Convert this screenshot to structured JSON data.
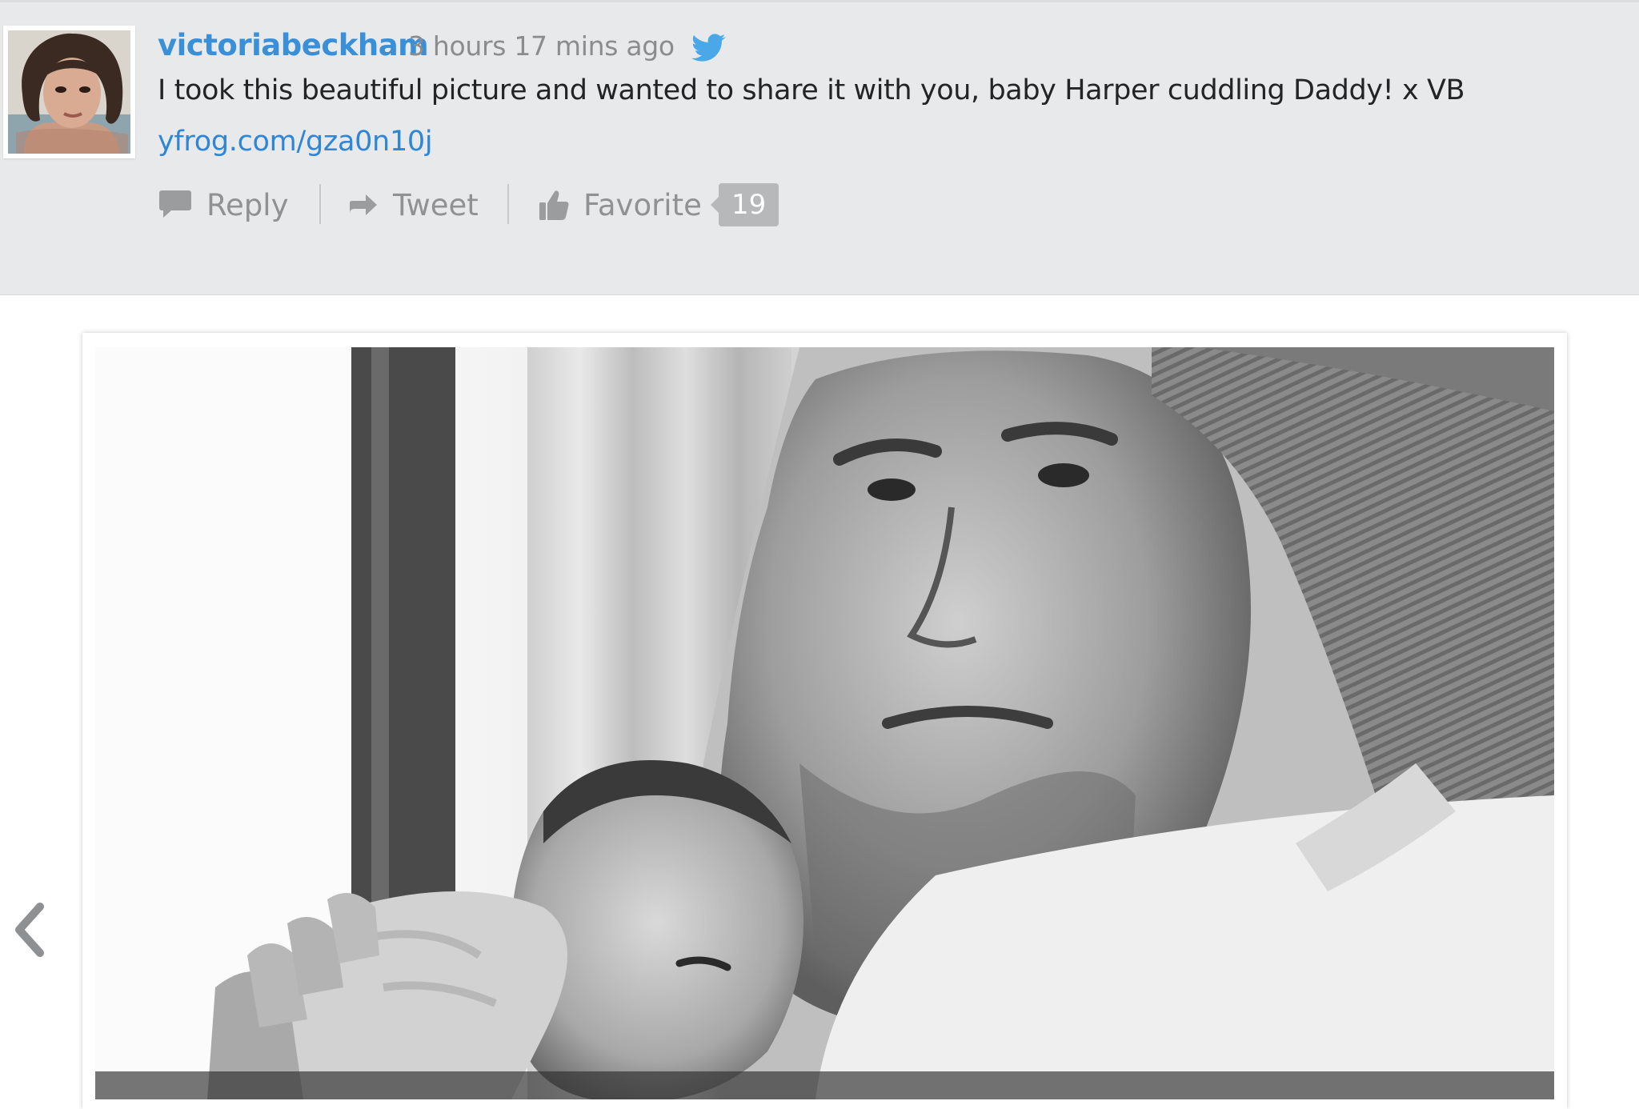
{
  "tweet": {
    "username": "victoriabeckham",
    "time_ago": "3 hours 17 mins ago",
    "source_icon": "twitter-bird-icon",
    "text": "I took this beautiful picture and wanted to share it with you, baby Harper cuddling Daddy! x VB",
    "link": "yfrog.com/gza0n10j",
    "actions": {
      "reply_label": "Reply",
      "retweet_label": "Tweet",
      "favorite_label": "Favorite",
      "favorite_count": "19"
    }
  },
  "colors": {
    "username": "#3a8fd9",
    "link": "#2e86d6",
    "tweet_background": "#e8e9ea",
    "action_text": "#8f9193",
    "badge": "#b6b8ba",
    "twitter_bird": "#4aa8e8"
  },
  "gallery": {
    "prev_icon": "chevron-left-icon",
    "photo_tone": "black-and-white"
  }
}
